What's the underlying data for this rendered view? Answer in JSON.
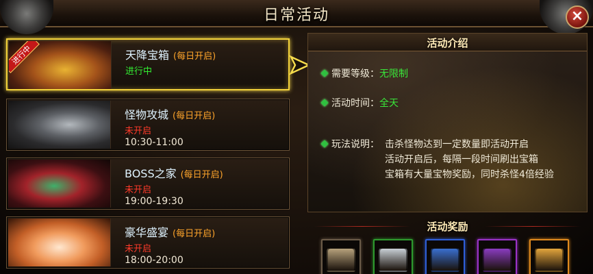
{
  "window": {
    "title": "日常活动",
    "close_label": "×"
  },
  "activities": [
    {
      "name": "天降宝箱",
      "freq": "(每日开启)",
      "status": "进行中",
      "time": "",
      "badge": "进行中",
      "selected": true
    },
    {
      "name": "怪物攻城",
      "freq": "(每日开启)",
      "status": "未开启",
      "time": "10:30-11:00",
      "selected": false
    },
    {
      "name": "BOSS之家",
      "freq": "(每日开启)",
      "status": "未开启",
      "time": "19:00-19:30",
      "selected": false
    },
    {
      "name": "豪华盛宴",
      "freq": "(每日开启)",
      "status": "未开启",
      "time": "18:00-20:00",
      "selected": false
    }
  ],
  "intro": {
    "title": "活动介绍",
    "level_label": "需要等级：",
    "level_value": "无限制",
    "time_label": "活动时间：",
    "time_value": "全天",
    "desc_label": "玩法说明：",
    "desc_lines": [
      "击杀怪物达到一定数量即活动开启",
      "活动开启后，每隔一段时间刷出宝箱",
      "宝箱有大量宝物奖励，同时杀怪4倍经验"
    ]
  },
  "rewards": {
    "title": "活动奖励",
    "items": [
      {
        "icon": "bronze-chest-icon",
        "frame_color": "#6b5b48",
        "chest_color": "#b7a27c"
      },
      {
        "icon": "silver-chest-icon",
        "frame_color": "#2e9a2e",
        "chest_color": "#c9d0d6"
      },
      {
        "icon": "blue-chest-icon",
        "frame_color": "#2e5ed8",
        "chest_color": "#3a6fd0"
      },
      {
        "icon": "purple-chest-icon",
        "frame_color": "#9a33c8",
        "chest_color": "#8a3cc0"
      },
      {
        "icon": "gold-chest-icon",
        "frame_color": "#e08a1e",
        "chest_color": "#e3a53c"
      }
    ]
  }
}
